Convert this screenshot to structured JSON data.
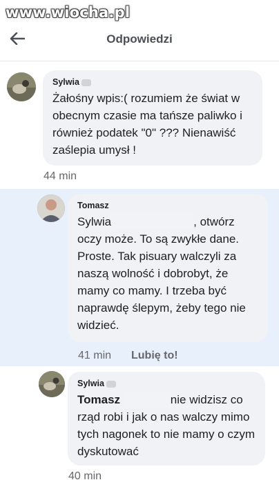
{
  "watermark": "www.wiocha.pl",
  "header": {
    "title": "Odpowiedzi"
  },
  "comments": [
    {
      "author": "Sylwia",
      "text": "Żałośny wpis:( rozumiem że świat w obecnym czasie ma tańsze paliwko  i również podatek \"0\" ??? Nienawiść zaślepia umysł !",
      "time": "44 min"
    },
    {
      "author": "Tomasz",
      "name_mention": "Sylwia",
      "text_after_mention": ", otwórz oczy może. To są zwykłe dane. Proste. Tak pisuary walczyli za naszą wolność i dobrobyt, że mamy co mamy. I trzeba być naprawdę ślepym, żeby tego nie widzieć.",
      "time": "41 min",
      "like_label": "Lubię to!"
    },
    {
      "author": "Sylwia",
      "name_mention": "Tomasz",
      "text_after_mention": "nie widzisz co rząd robi i jak o nas walczy mimo tych nagonek to nie mamy o czym dyskutować",
      "time": "40 min"
    }
  ],
  "colors": {
    "highlight": "#e7f0fb",
    "bubble": "#f0f2f5",
    "meta": "#65676b"
  },
  "icons": {
    "back": "arrow-left-icon"
  }
}
